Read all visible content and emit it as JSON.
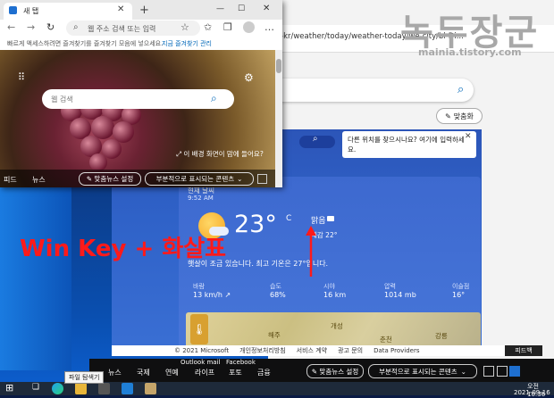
{
  "watermark": {
    "title": "녹두장군",
    "url": "mainia.tistory.com"
  },
  "annotation": {
    "text": "Win Key + 화살표",
    "color": "#ff1a1a"
  },
  "front_browser": {
    "tab_title": "새 탭",
    "tab_close": "✕",
    "new_tab": "+",
    "address_placeholder": "웹 주소 검색 또는 입력",
    "favorites_hint": "빠르게 액세스하려면 즐겨찾기를 즐겨찾기 모음에 넣으세요.",
    "favorites_link": "지금 즐겨찾기 관리",
    "search_placeholder": "웹 검색",
    "bg_info": "⤢ 이 배경 화면이 맘에 들어요?",
    "nav_tabs": [
      "피드",
      "뉴스"
    ],
    "personalize": "✎ 맞춤뉴스 설정",
    "content_toggle": "부분적으로 표시되는 콘텐츠",
    "icons": {
      "back": "back-arrow-icon",
      "forward": "forward-arrow-icon",
      "refresh": "refresh-icon",
      "apps": "apps-grid-icon",
      "settings": "gear-icon"
    }
  },
  "back_browser": {
    "url_fragment": "-kr/weather/today/weather-today/we-city/bl-Di...",
    "customize": "맞춤화",
    "location_tip": "다른 위치를 찾으시나요? 여기에 입력하세요.",
    "weather": {
      "location": "현재 날씨",
      "time": "9:52 AM",
      "temp": "23°",
      "unit": "C",
      "condition": "맑음",
      "feels_like": "체감  22°",
      "description": "햇살이 조금 있습니다. 최고 기온은 27°입니다.",
      "stats": [
        {
          "label": "바람",
          "value": "13 km/h ↗"
        },
        {
          "label": "습도",
          "value": "68%"
        },
        {
          "label": "시야",
          "value": "16 km"
        },
        {
          "label": "압력",
          "value": "1014 mb"
        },
        {
          "label": "이슬점",
          "value": "16°"
        }
      ],
      "map_labels": [
        "개성",
        "해주",
        "춘천",
        "강릉"
      ]
    },
    "footer": [
      "© 2021 Microsoft",
      "개인정보처리방침",
      "서비스 계약",
      "광고 문의",
      "Data Providers"
    ],
    "feedback": "피드백"
  },
  "bottom_news_bar": {
    "top_labels": [
      "Outlook mail",
      "Facebook"
    ],
    "tabs": [
      "파일 탐색기",
      "뉴스",
      "국제",
      "연예",
      "라이프",
      "포토",
      "금융"
    ],
    "personalize": "✎ 맞춤뉴스 설정",
    "content_toggle": "부분적으로 표시되는 콘텐츠"
  },
  "taskbar": {
    "tooltip": "파일 탐색기",
    "clock_time": "오전 10:36",
    "clock_date": "2021-09-16"
  }
}
